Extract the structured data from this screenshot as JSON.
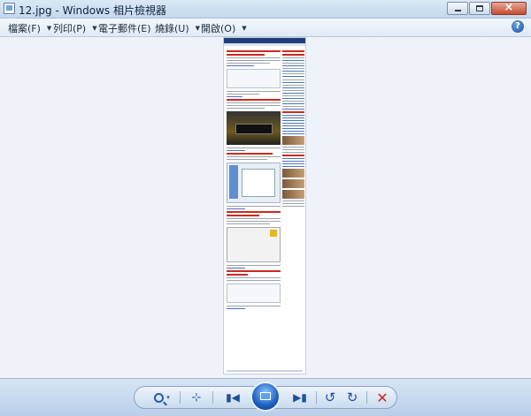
{
  "window": {
    "title": "12.jpg - Windows 相片檢視器"
  },
  "menu": {
    "items": [
      {
        "label": "檔案(F)"
      },
      {
        "label": "列印(P)"
      },
      {
        "label": "電子郵件(E)"
      },
      {
        "label": "燒錄(U)"
      },
      {
        "label": "開啟(O)"
      }
    ],
    "help_label": "?"
  },
  "toolbar": {
    "zoom_icon": "magnifier-icon",
    "fit_icon": "actual-size-icon",
    "prev_icon": "previous-icon",
    "slideshow_icon": "slideshow-icon",
    "next_icon": "next-icon",
    "rotate_ccw_icon": "rotate-counterclockwise-icon",
    "rotate_cw_icon": "rotate-clockwise-icon",
    "delete_icon": "delete-icon"
  },
  "colors": {
    "accent": "#1f4f9a",
    "delete": "#c8281e",
    "viewer_background": "#eef3f9"
  }
}
